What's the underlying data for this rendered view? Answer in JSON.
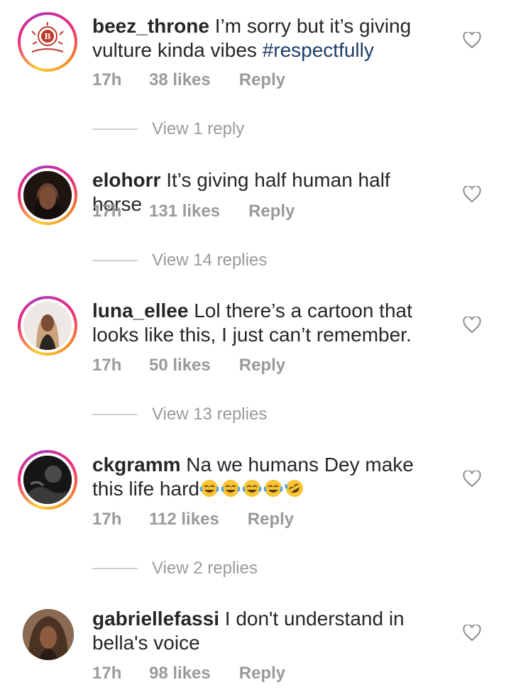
{
  "comments": [
    {
      "username": "beez_throne",
      "text": "I’m sorry but it’s giving vulture kinda vibes",
      "hashtag": "#respectfully",
      "time": "17h",
      "likes": "38 likes",
      "reply_label": "Reply",
      "view_replies": "View 1 reply"
    },
    {
      "username": "elohorr",
      "text": "It’s giving half human half horse",
      "time": "17h",
      "likes": "131 likes",
      "reply_label": "Reply",
      "view_replies": "View 14 replies"
    },
    {
      "username": "luna_ellee",
      "text": "Lol there’s a cartoon that looks like this, I just can’t remember.",
      "time": "17h",
      "likes": "50 likes",
      "reply_label": "Reply",
      "view_replies": "View 13 replies"
    },
    {
      "username": "ckgramm",
      "text": "Na we humans Dey make this life hard",
      "emojis": [
        "face-with-tears-of-joy",
        "face-with-tears-of-joy",
        "face-with-tears-of-joy",
        "face-with-tears-of-joy",
        "rolling-on-floor-laughing"
      ],
      "time": "17h",
      "likes": "112 likes",
      "reply_label": "Reply",
      "view_replies": "View 2 replies"
    },
    {
      "username": "gabriellefassi",
      "text": "I don't understand in bella's voice",
      "time": "17h",
      "likes": "98 likes",
      "reply_label": "Reply"
    }
  ],
  "icons": {
    "like": "heart-outline-icon"
  },
  "colors": {
    "text": "#262626",
    "muted": "#9a9a9a",
    "hashtag": "#1e3e6a",
    "story_ring_start": "#f9ce34",
    "story_ring_end": "#ee2a7b"
  }
}
